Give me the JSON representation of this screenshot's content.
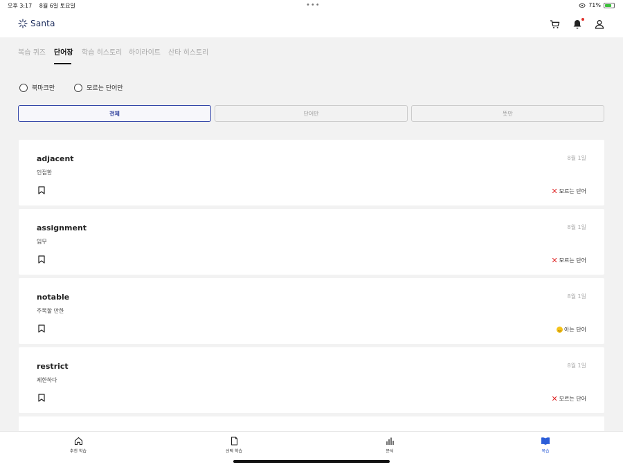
{
  "status_bar": {
    "time": "오후 3:17",
    "date": "8월 6일 토요일",
    "battery": "71%",
    "battery_level": 0.71
  },
  "header": {
    "logo": "Santa",
    "icons": [
      "cart-icon",
      "bell-icon",
      "user-icon"
    ]
  },
  "tabs": [
    {
      "label": "복습 퀴즈",
      "active": false
    },
    {
      "label": "단어장",
      "active": true
    },
    {
      "label": "학습 히스토리",
      "active": false
    },
    {
      "label": "하이라이트",
      "active": false
    },
    {
      "label": "산타 히스토리",
      "active": false
    }
  ],
  "radio_filters": [
    {
      "label": "북마크만",
      "checked": false
    },
    {
      "label": "모르는 단어만",
      "checked": false
    }
  ],
  "view_filters": [
    {
      "label": "전체",
      "active": true
    },
    {
      "label": "단어만",
      "active": false
    },
    {
      "label": "뜻만",
      "active": false
    }
  ],
  "words": [
    {
      "word": "adjacent",
      "meaning": "인접한",
      "date": "8월 1일",
      "status": "모르는 단어",
      "known": false
    },
    {
      "word": "assignment",
      "meaning": "임무",
      "date": "8월 1일",
      "status": "모르는 단어",
      "known": false
    },
    {
      "word": "notable",
      "meaning": "주목할 만한",
      "date": "8월 1일",
      "status": "아는 단어",
      "known": true
    },
    {
      "word": "restrict",
      "meaning": "제한하다",
      "date": "8월 1일",
      "status": "모르는 단어",
      "known": false
    }
  ],
  "bottom_nav": [
    {
      "label": "추천 학습",
      "icon": "home-icon",
      "active": false
    },
    {
      "label": "선택 학습",
      "icon": "document-icon",
      "active": false
    },
    {
      "label": "분석",
      "icon": "bar-chart-icon",
      "active": false
    },
    {
      "label": "복습",
      "icon": "book-icon",
      "active": true
    }
  ],
  "colors": {
    "accent": "#3346a8",
    "active_nav": "#2b5dd8",
    "unknown_mark": "#e02b2b"
  }
}
